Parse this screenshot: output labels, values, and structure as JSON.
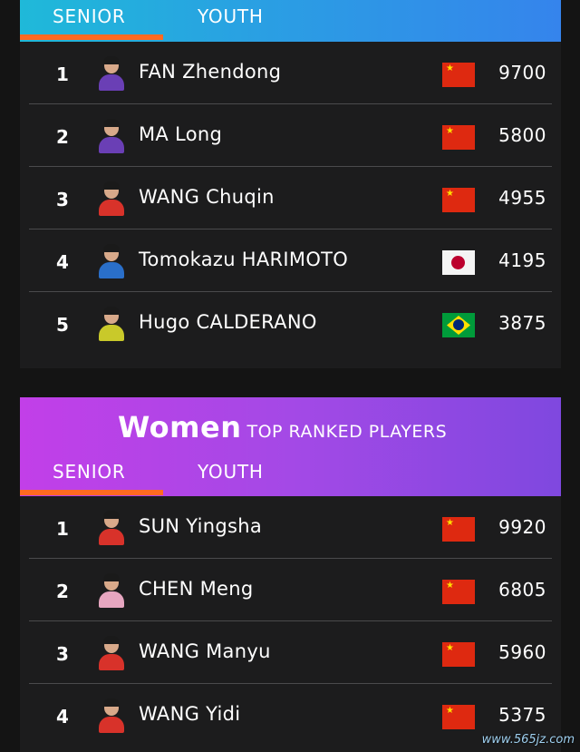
{
  "men": {
    "tabs": {
      "senior": "SENIOR",
      "youth": "YOUTH"
    },
    "players": [
      {
        "rank": "1",
        "name": "FAN Zhendong",
        "country": "china-flag",
        "points": "9700",
        "kit_color": "#6a3fb5"
      },
      {
        "rank": "2",
        "name": "MA Long",
        "country": "china-flag",
        "points": "5800",
        "kit_color": "#6a3fb5"
      },
      {
        "rank": "3",
        "name": "WANG Chuqin",
        "country": "china-flag",
        "points": "4955",
        "kit_color": "#d8322a"
      },
      {
        "rank": "4",
        "name": "Tomokazu HARIMOTO",
        "country": "japan-flag",
        "points": "4195",
        "kit_color": "#2a6fc9"
      },
      {
        "rank": "5",
        "name": "Hugo CALDERANO",
        "country": "brazil-flag",
        "points": "3875",
        "kit_color": "#c9c92a"
      }
    ]
  },
  "women": {
    "title": "Women",
    "subtitle": "TOP RANKED PLAYERS",
    "tabs": {
      "senior": "SENIOR",
      "youth": "YOUTH"
    },
    "players": [
      {
        "rank": "1",
        "name": "SUN Yingsha",
        "country": "china-flag",
        "points": "9920",
        "kit_color": "#d8322a"
      },
      {
        "rank": "2",
        "name": "CHEN Meng",
        "country": "china-flag",
        "points": "6805",
        "kit_color": "#e6a6c0"
      },
      {
        "rank": "3",
        "name": "WANG Manyu",
        "country": "china-flag",
        "points": "5960",
        "kit_color": "#d8322a"
      },
      {
        "rank": "4",
        "name": "WANG Yidi",
        "country": "china-flag",
        "points": "5375",
        "kit_color": "#d8322a"
      }
    ]
  },
  "watermark": "www.565jz.com",
  "colors": {
    "men_header_accent": "#2a9fe3",
    "women_header_accent": "#a449e6",
    "active_tab_underline": "#ff6a21"
  }
}
